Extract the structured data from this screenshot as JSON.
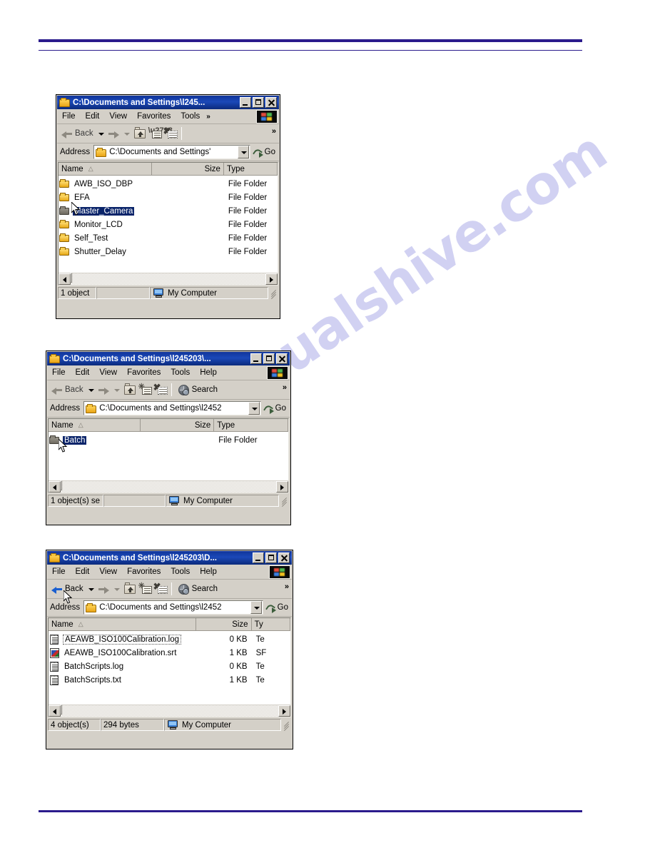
{
  "page": {
    "watermark": "manualshive.com",
    "rule_color": "#2b1b8c"
  },
  "icons": {
    "folder": "folder-icon",
    "search": "search-icon",
    "go": "go-arrow-icon",
    "up": "up-folder-icon",
    "views": "views-icon",
    "new_folder": "new-folder-icon",
    "windows_logo": "windows-logo-icon",
    "my_computer": "my-computer-icon"
  },
  "windows": [
    {
      "title": "C:\\Documents and Settings\\l245...",
      "menu": [
        "File",
        "Edit",
        "View",
        "Favorites",
        "Tools"
      ],
      "menu_overflow": "»",
      "toolbar": {
        "back_label": "Back",
        "search_label": "",
        "overflow": "»",
        "show_search": false,
        "back_enabled": false
      },
      "address": {
        "label": "Address",
        "value": "C:\\Documents and Settings'",
        "go_label": "Go"
      },
      "columns": [
        "Name",
        "Size",
        "Type"
      ],
      "sort_glyph": "△",
      "rows": [
        {
          "icon": "folder-icon",
          "name": "AWB_ISO_DBP",
          "size": "",
          "type": "File Folder",
          "state": "normal"
        },
        {
          "icon": "folder-icon",
          "name": "EFA",
          "size": "",
          "type": "File Folder",
          "state": "normal"
        },
        {
          "icon": "folder-open-icon",
          "name": "Master_Camera",
          "size": "",
          "type": "File Folder",
          "state": "selected"
        },
        {
          "icon": "folder-icon",
          "name": "Monitor_LCD",
          "size": "",
          "type": "File Folder",
          "state": "normal"
        },
        {
          "icon": "folder-icon",
          "name": "Self_Test",
          "size": "",
          "type": "File Folder",
          "state": "normal"
        },
        {
          "icon": "folder-icon",
          "name": "Shutter_Delay",
          "size": "",
          "type": "File Folder",
          "state": "normal"
        }
      ],
      "status": {
        "objects": "1 object",
        "bytes": "",
        "location": "My Computer"
      }
    },
    {
      "title": "C:\\Documents and Settings\\l245203\\...",
      "menu": [
        "File",
        "Edit",
        "View",
        "Favorites",
        "Tools",
        "Help"
      ],
      "menu_overflow": "",
      "toolbar": {
        "back_label": "Back",
        "search_label": "Search",
        "overflow": "»",
        "show_search": true,
        "back_enabled": false
      },
      "address": {
        "label": "Address",
        "value": "C:\\Documents and Settings\\l2452",
        "go_label": "Go"
      },
      "columns": [
        "Name",
        "Size",
        "Type"
      ],
      "sort_glyph": "△",
      "rows": [
        {
          "icon": "folder-open-icon",
          "name": "Batch",
          "size": "",
          "type": "File Folder",
          "state": "selected"
        }
      ],
      "status": {
        "objects": "1 object(s) se",
        "bytes": "",
        "location": "My Computer"
      }
    },
    {
      "title": "C:\\Documents and Settings\\l245203\\D...",
      "menu": [
        "File",
        "Edit",
        "View",
        "Favorites",
        "Tools",
        "Help"
      ],
      "menu_overflow": "",
      "toolbar": {
        "back_label": "Back",
        "search_label": "Search",
        "overflow": "»",
        "show_search": true,
        "back_enabled": true
      },
      "address": {
        "label": "Address",
        "value": "C:\\Documents and Settings\\l2452",
        "go_label": "Go"
      },
      "columns": [
        "Name",
        "Size",
        "Ty"
      ],
      "sort_glyph": "△",
      "rows": [
        {
          "icon": "text-file-icon",
          "name": "AEAWB_ISO100Calibration.log",
          "size": "0 KB",
          "type": "Te",
          "state": "focused"
        },
        {
          "icon": "srt-file-icon",
          "name": "AEAWB_ISO100Calibration.srt",
          "size": "1 KB",
          "type": "SF",
          "state": "normal"
        },
        {
          "icon": "text-file-icon",
          "name": "BatchScripts.log",
          "size": "0 KB",
          "type": "Te",
          "state": "normal"
        },
        {
          "icon": "text-file-icon",
          "name": "BatchScripts.txt",
          "size": "1 KB",
          "type": "Te",
          "state": "normal"
        }
      ],
      "status": {
        "objects": "4 object(s)",
        "bytes": "294 bytes",
        "location": "My Computer"
      }
    }
  ]
}
